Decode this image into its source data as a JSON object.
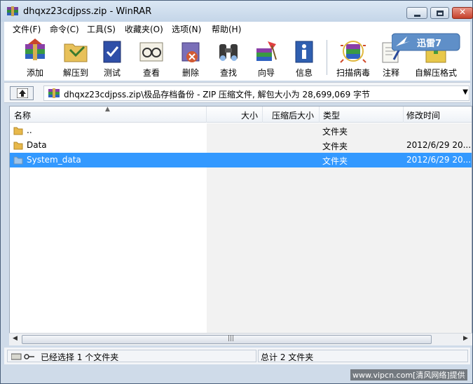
{
  "window": {
    "title": "dhqxz23cdjpss.zip - WinRAR",
    "minimize_glyph": "",
    "maximize_glyph": "",
    "close_glyph": "✕"
  },
  "menu": [
    "文件(F)",
    "命令(C)",
    "工具(S)",
    "收藏夹(O)",
    "选项(N)",
    "帮助(H)"
  ],
  "toolbar": {
    "add": "添加",
    "extract_to": "解压到",
    "test": "测试",
    "view": "查看",
    "delete": "删除",
    "find": "查找",
    "wizard": "向导",
    "info": "信息",
    "virus_scan": "扫描病毒",
    "comment": "注释",
    "sfx": "自解压格式",
    "xunlei_label": "迅雷7"
  },
  "address": {
    "path": "dhqxz23cdjpss.zip\\极品存档备份 - ZIP 压缩文件, 解包大小为 28,699,069 字节"
  },
  "columns": {
    "name": "名称",
    "size": "大小",
    "packed": "压缩后大小",
    "type": "类型",
    "modified": "修改时间"
  },
  "files": [
    {
      "name": "..",
      "size": "",
      "packed": "",
      "type": "文件夹",
      "modified": "",
      "selected": false
    },
    {
      "name": "Data",
      "size": "",
      "packed": "",
      "type": "文件夹",
      "modified": "2012/6/29 20...",
      "selected": false
    },
    {
      "name": "System_data",
      "size": "",
      "packed": "",
      "type": "文件夹",
      "modified": "2012/6/29 20...",
      "selected": true
    }
  ],
  "scroll": {
    "left": "◀",
    "right": "▶",
    "grip": "|||"
  },
  "status": {
    "selection": "已经选择 1 个文件夹",
    "total": "总计 2 文件夹"
  },
  "watermark": "www.vipcn.com[清风网络]提供",
  "colors": {
    "selection": "#3399ff",
    "folder": "#e8b84a"
  }
}
